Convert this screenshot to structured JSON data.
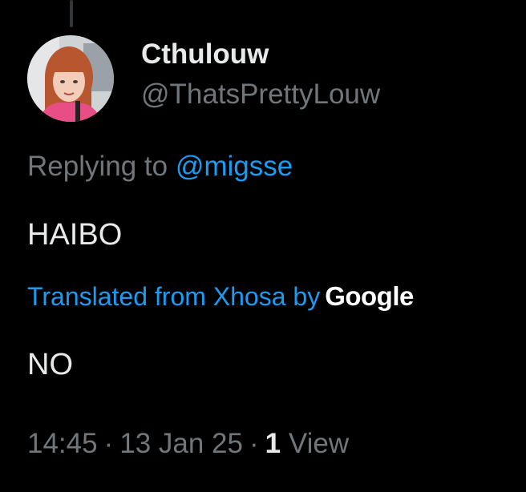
{
  "author": {
    "display_name": "Cthulouw",
    "handle": "@ThatsPrettyLouw",
    "avatar_icon": "profile-photo"
  },
  "reply": {
    "prefix": "Replying to ",
    "mention": "@migsse"
  },
  "tweet": {
    "text": "HAIBO"
  },
  "translation": {
    "label": "Translated from Xhosa by",
    "provider": "Google",
    "text": "NO"
  },
  "meta": {
    "time": "14:45",
    "separator": "·",
    "date": "13 Jan 25",
    "views_count": "1",
    "views_label": "View"
  },
  "colors": {
    "background": "#000000",
    "primary_text": "#e7e9ea",
    "secondary_text": "#71767b",
    "accent": "#1d9bf0"
  }
}
